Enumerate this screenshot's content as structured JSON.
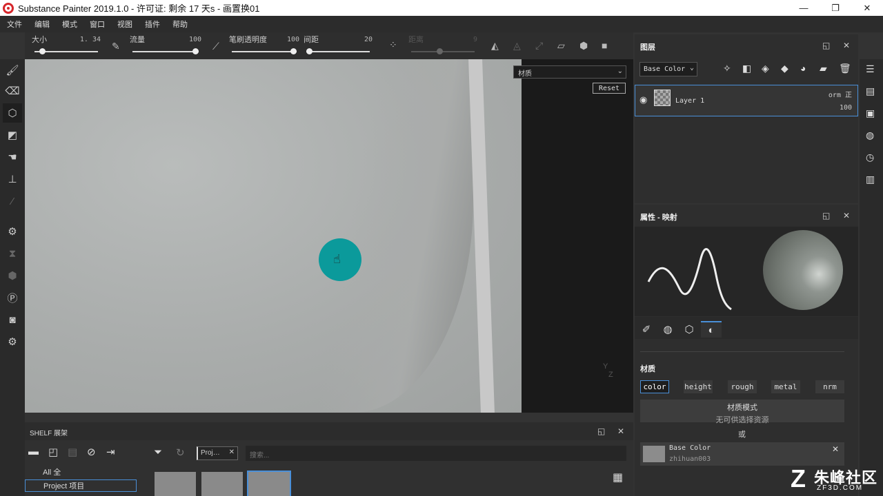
{
  "window": {
    "title": "Substance Painter 2019.1.0 - 许可证: 剩余 17 天s - 画置换01",
    "controls": [
      "—",
      "❐",
      "✕"
    ]
  },
  "menu": [
    "文件",
    "编辑",
    "模式",
    "窗口",
    "视图",
    "插件",
    "帮助"
  ],
  "toolbar": {
    "size": {
      "label": "大小",
      "value": "1. 34",
      "level": 0.08
    },
    "flow": {
      "label": "流量",
      "value": "100",
      "level": 1.0
    },
    "stroke_opacity": {
      "label": "笔刷透明度",
      "value": "100",
      "level": 1.0
    },
    "spacing": {
      "label": "间距",
      "value": "20",
      "level": 0.0
    },
    "distance": {
      "label": "距离",
      "value": "9",
      "level": 0.45
    }
  },
  "viewport": {
    "material_select": "材质",
    "reset_label": "Reset",
    "axis_y": "Y",
    "axis_z": "Z",
    "brush_color": "#0b9a9b"
  },
  "shelf": {
    "title": "SHELF  展架",
    "categories": [
      "All 全",
      "Project 项目"
    ],
    "filter_tag": "Proj…",
    "search_placeholder": "搜索..."
  },
  "layers": {
    "title": "图层",
    "channel": "Base Color",
    "layer": {
      "name": "Layer 1",
      "blend": "orm 正",
      "opacity": "100"
    }
  },
  "properties": {
    "title": "属性 - 映射",
    "section": "材质",
    "channels": [
      "color",
      "height",
      "rough",
      "metal",
      "nrm"
    ],
    "material_mode": "材质模式",
    "no_resource": "无可供选择资源",
    "or_label": "或",
    "base_color": {
      "label": "Base Color",
      "resource": "zhihuan003",
      "swatch": "#8c8c8c"
    }
  },
  "watermark": {
    "main": "朱峰社区",
    "sub": "ZF3D.COM"
  },
  "colors": {
    "accent": "#4a90d9",
    "teal": "#0b9a9b",
    "logo": "#d6262b"
  }
}
